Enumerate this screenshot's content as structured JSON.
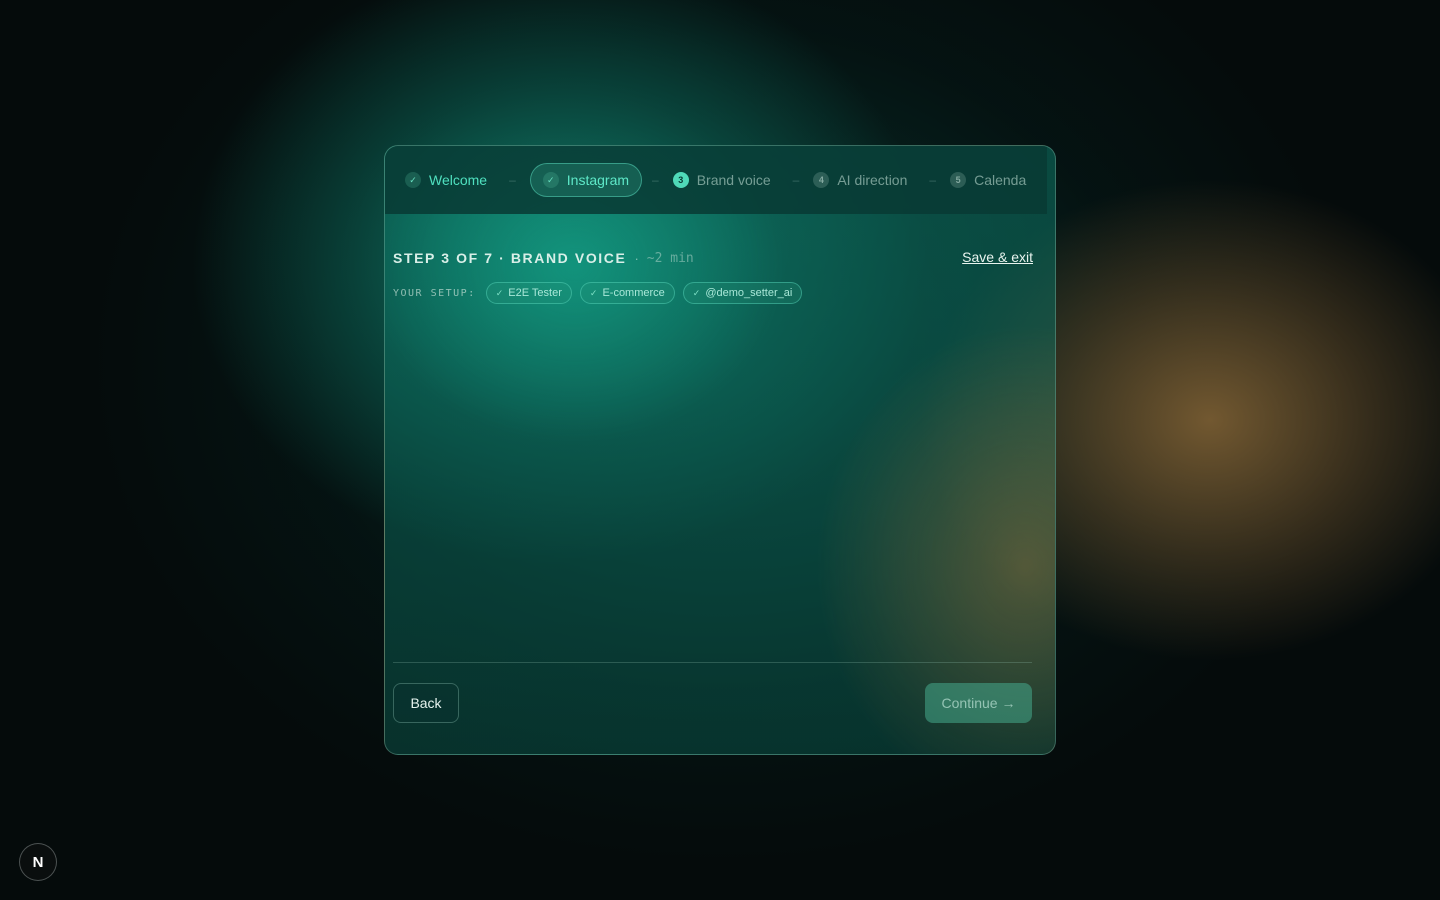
{
  "stepper": {
    "steps": [
      {
        "label": "Welcome",
        "badge": "✓"
      },
      {
        "label": "Instagram",
        "badge": "✓"
      },
      {
        "label": "Brand voice",
        "badge": "3"
      },
      {
        "label": "AI direction",
        "badge": "4"
      },
      {
        "label": "Calenda",
        "badge": "5"
      }
    ],
    "separator": "–"
  },
  "header": {
    "step_title": "STEP 3 OF 7 · BRAND VOICE",
    "dot": "·",
    "eta": "~2 min",
    "save_exit": "Save & exit"
  },
  "setup": {
    "label": "YOUR SETUP:",
    "chips": [
      {
        "check": "✓",
        "text": "E2E Tester"
      },
      {
        "check": "✓",
        "text": "E-commerce"
      },
      {
        "check": "✓",
        "text": "@demo_setter_ai"
      }
    ]
  },
  "footer": {
    "back_label": "Back",
    "continue_label": "Continue →"
  },
  "badge_logo": "N",
  "colors": {
    "accent": "#4fe0bf",
    "warm": "#8a6a3c",
    "background": "#050b0b"
  }
}
